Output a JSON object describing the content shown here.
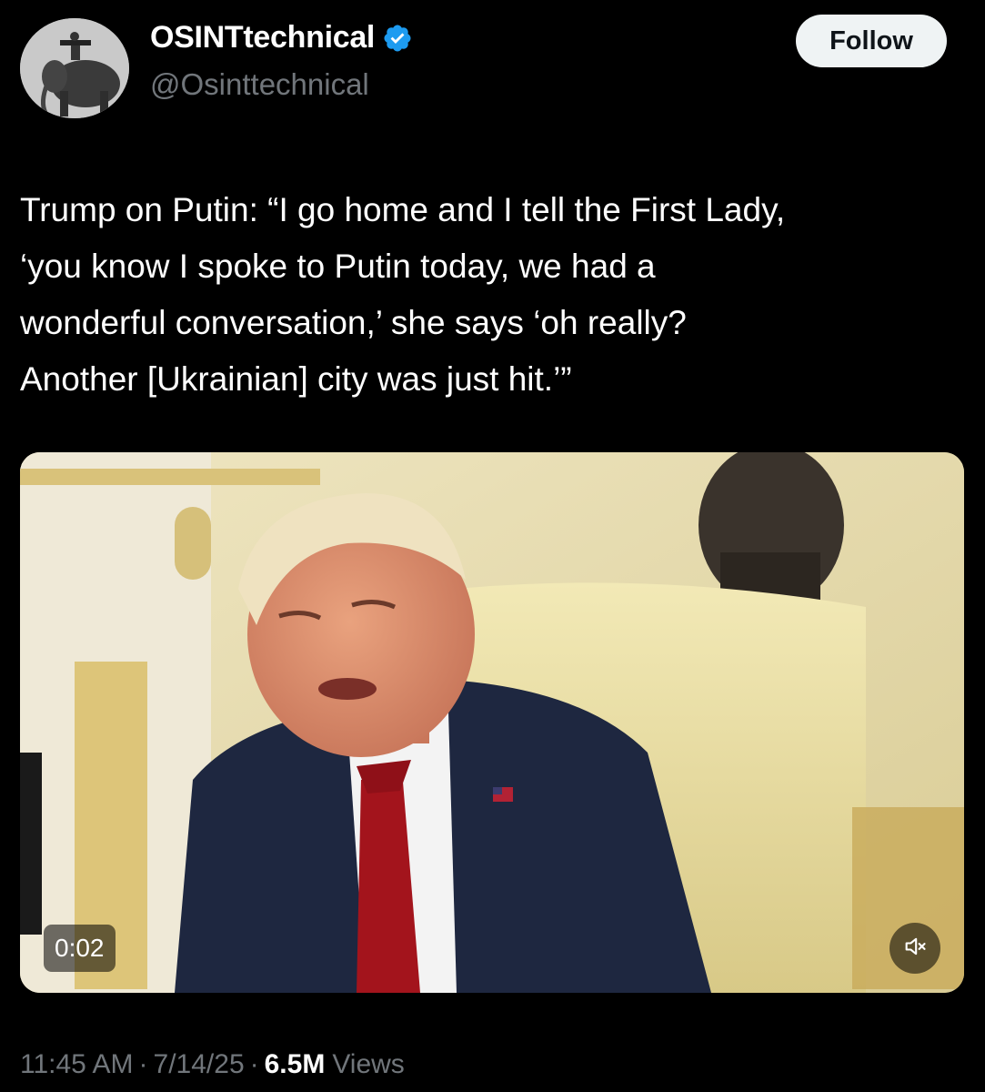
{
  "author": {
    "display_name": "OSINTtechnical",
    "handle": "@Osinttechnical",
    "avatar_icon": "avatar-image",
    "verified_icon": "verified-badge-icon",
    "verified_color": "#1d9bf0"
  },
  "follow_button": {
    "label": "Follow"
  },
  "tweet": {
    "text": "Trump on Putin: “I go home and I tell the First Lady,\n‘you know I spoke to Putin today, we had a\nwonderful conversation,’ she says ‘oh really?\nAnother [Ukrainian] city was just hit.’”"
  },
  "media": {
    "type": "video",
    "elapsed": "0:02",
    "mute_icon": "muted-speaker-icon"
  },
  "meta": {
    "time": "11:45 AM",
    "separator": "·",
    "date": "7/14/25",
    "views_count": "6.5M",
    "views_label": "Views"
  },
  "colors": {
    "background": "#000000",
    "text": "#ffffff",
    "secondary_text": "#71767b",
    "follow_bg": "#eff3f4"
  }
}
